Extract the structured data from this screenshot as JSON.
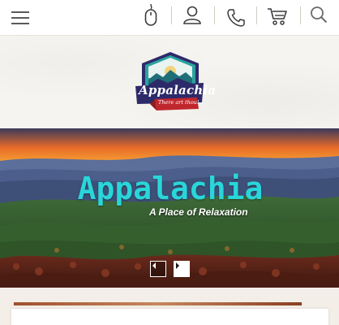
{
  "nav": {
    "menu_icon": "hamburger-menu-icon",
    "mouse_icon": "mouse-icon",
    "account_icon": "user-icon",
    "phone_icon": "phone-icon",
    "cart_icon": "cart-icon",
    "search_icon": "search-icon"
  },
  "logo": {
    "script": "Appalachia",
    "tagline": "There art thou!"
  },
  "hero": {
    "title": "Appalachia",
    "subtitle": "A Place of Relaxation",
    "prev_icon": "triangle-left-icon",
    "next_icon": "triangle-right-icon"
  },
  "colors": {
    "title_accent": "#29d6da",
    "logo_navy": "#2d2a6a",
    "logo_teal": "#2aa3a0",
    "logo_red": "#c0272d"
  }
}
